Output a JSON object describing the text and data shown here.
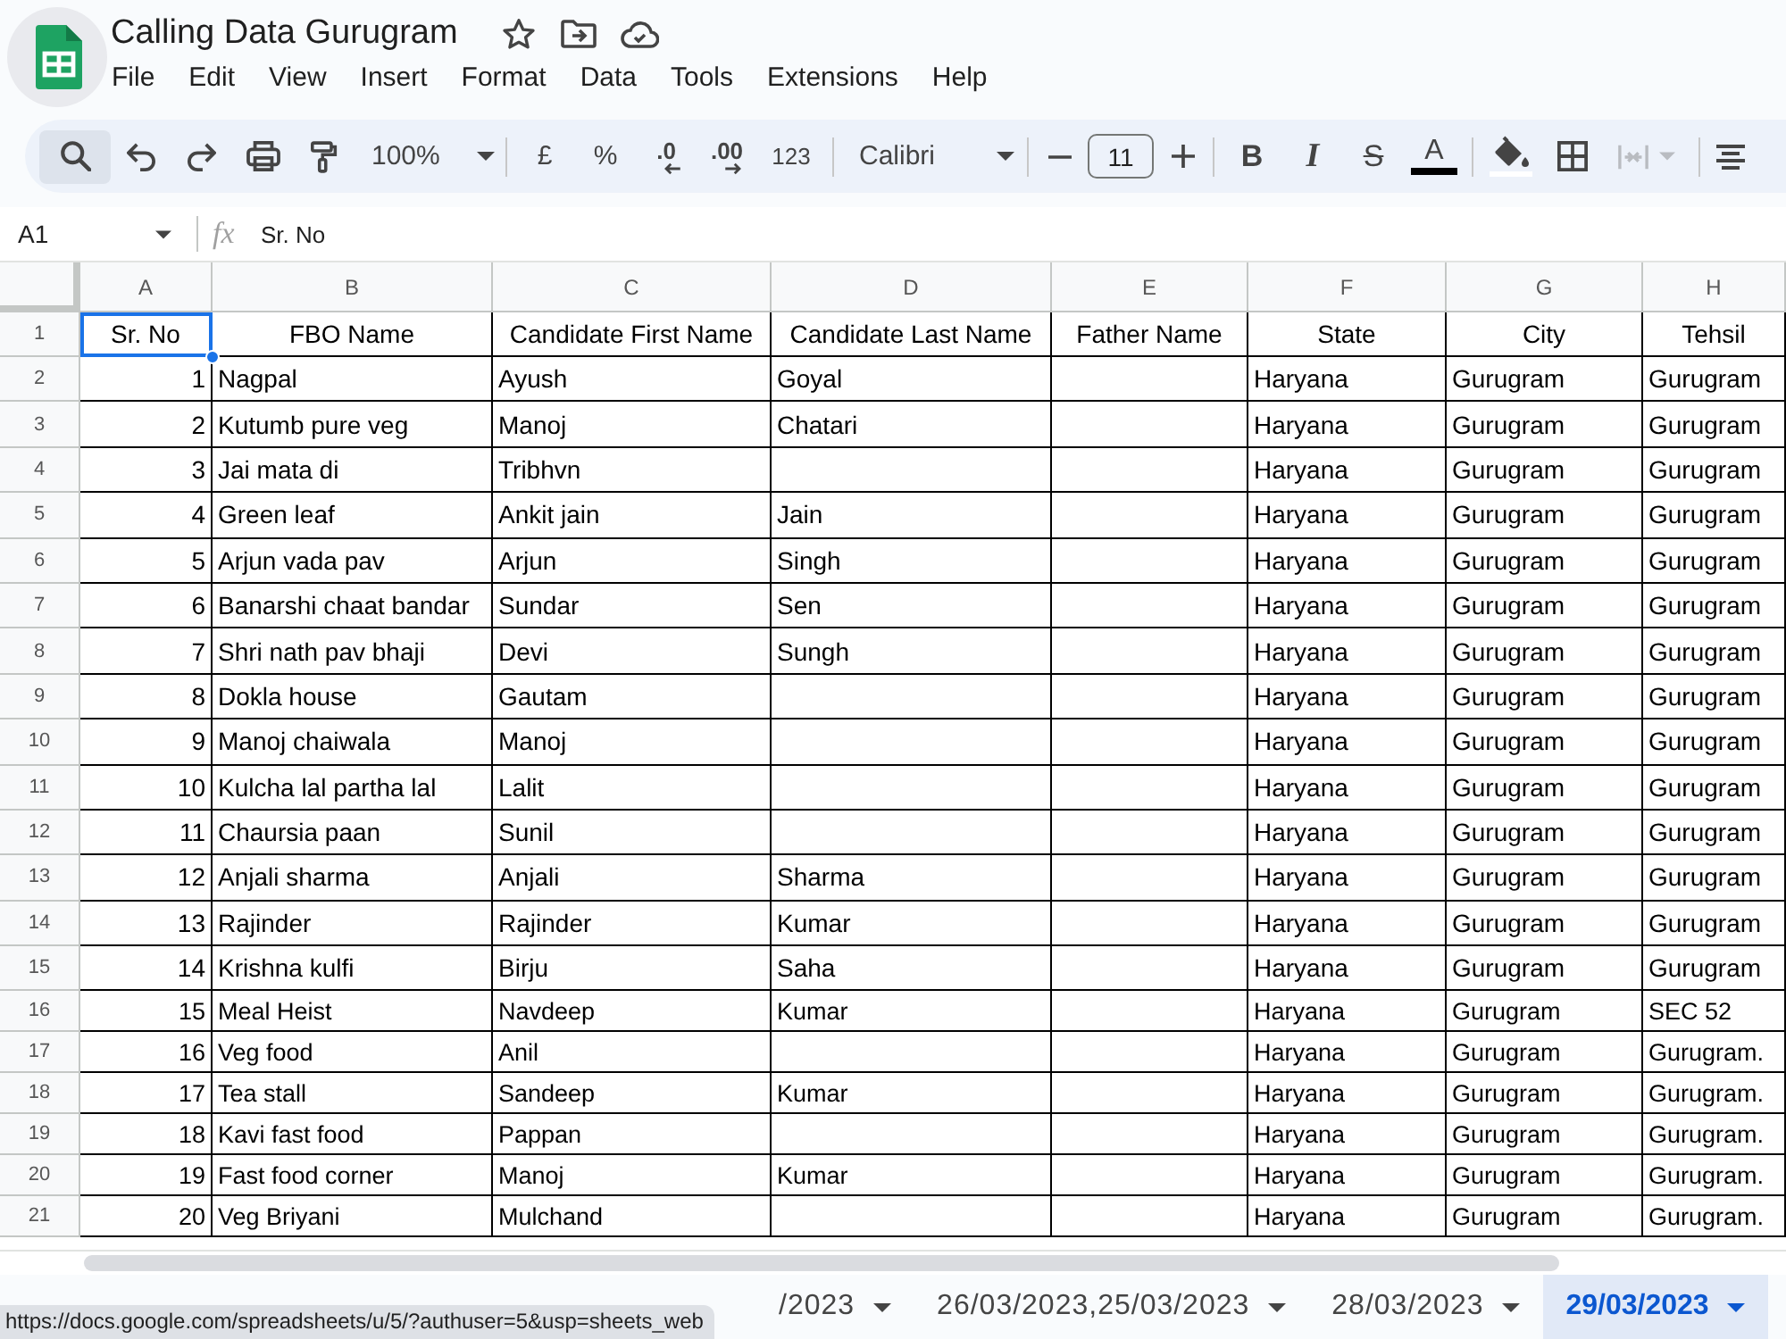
{
  "app": {
    "title": "Calling Data Gurugram",
    "menu": [
      "File",
      "Edit",
      "View",
      "Insert",
      "Format",
      "Data",
      "Tools",
      "Extensions",
      "Help"
    ]
  },
  "toolbar": {
    "search_selected": true,
    "zoom": "100%",
    "currency": "£",
    "percent": "%",
    "decrease_decimal": ".0",
    "increase_decimal": ".00",
    "number_format": "123",
    "font": "Calibri",
    "font_size": "11",
    "bold": "B",
    "italic": "I",
    "strikethrough": "S",
    "text_color": "A",
    "merge_disabled": true
  },
  "formula_bar": {
    "cell_ref": "A1",
    "fx": "fx",
    "content": "Sr. No"
  },
  "sheet": {
    "columns": [
      {
        "letter": "A",
        "selected": true
      },
      {
        "letter": "B",
        "selected": false
      },
      {
        "letter": "C",
        "selected": false
      },
      {
        "letter": "D",
        "selected": false
      },
      {
        "letter": "E",
        "selected": false
      },
      {
        "letter": "F",
        "selected": false
      },
      {
        "letter": "G",
        "selected": false
      },
      {
        "letter": "H",
        "selected": false
      }
    ],
    "rows": [
      {
        "row": "1",
        "kind": "header",
        "selected": true,
        "cells": [
          "Sr. No",
          "FBO Name",
          "Candidate First Name",
          "Candidate Last Name",
          "Father Name",
          "State",
          "City",
          "Tehsil"
        ]
      },
      {
        "row": "2",
        "kind": "entry",
        "selected": false,
        "cells": [
          "1",
          "Nagpal",
          "Ayush",
          "Goyal",
          null,
          "Haryana",
          "Gurugram",
          "Gurugram"
        ]
      },
      {
        "row": "3",
        "kind": "entry",
        "selected": false,
        "cells": [
          "2",
          "Kutumb pure veg",
          "Manoj",
          "Chatari",
          null,
          "Haryana",
          "Gurugram",
          "Gurugram"
        ]
      },
      {
        "row": "4",
        "kind": "entry",
        "selected": false,
        "cells": [
          "3",
          "Jai mata di",
          "Tribhvn",
          null,
          null,
          "Haryana",
          "Gurugram",
          "Gurugram"
        ]
      },
      {
        "row": "5",
        "kind": "entry",
        "selected": false,
        "cells": [
          "4",
          "Green leaf",
          "Ankit jain",
          "Jain",
          null,
          "Haryana",
          "Gurugram",
          "Gurugram"
        ]
      },
      {
        "row": "6",
        "kind": "entry",
        "selected": false,
        "cells": [
          "5",
          "Arjun vada pav",
          "Arjun",
          "Singh",
          null,
          "Haryana",
          "Gurugram",
          "Gurugram"
        ]
      },
      {
        "row": "7",
        "kind": "entry",
        "selected": false,
        "cells": [
          "6",
          "Banarshi chaat bandar",
          "Sundar",
          "Sen",
          null,
          "Haryana",
          "Gurugram",
          "Gurugram"
        ]
      },
      {
        "row": "8",
        "kind": "entry",
        "selected": false,
        "cells": [
          "7",
          "Shri nath pav bhaji",
          "Devi",
          "Sungh",
          null,
          "Haryana",
          "Gurugram",
          "Gurugram"
        ]
      },
      {
        "row": "9",
        "kind": "entry",
        "selected": false,
        "cells": [
          "8",
          "Dokla house",
          "Gautam",
          null,
          null,
          "Haryana",
          "Gurugram",
          "Gurugram"
        ]
      },
      {
        "row": "10",
        "kind": "entry",
        "selected": false,
        "cells": [
          "9",
          "Manoj chaiwala",
          "Manoj",
          null,
          null,
          "Haryana",
          "Gurugram",
          "Gurugram"
        ]
      },
      {
        "row": "11",
        "kind": "entry",
        "selected": false,
        "cells": [
          "10",
          "Kulcha lal partha lal",
          "Lalit",
          null,
          null,
          "Haryana",
          "Gurugram",
          "Gurugram"
        ]
      },
      {
        "row": "12",
        "kind": "entry",
        "selected": false,
        "cells": [
          "11",
          "Chaursia paan",
          "Sunil",
          null,
          null,
          "Haryana",
          "Gurugram",
          "Gurugram"
        ]
      },
      {
        "row": "13",
        "kind": "entry",
        "selected": false,
        "cells": [
          "12",
          "Anjali sharma",
          "Anjali",
          "Sharma",
          null,
          "Haryana",
          "Gurugram",
          "Gurugram"
        ]
      },
      {
        "row": "14",
        "kind": "entry",
        "selected": false,
        "cells": [
          "13",
          "Rajinder",
          "Rajinder",
          "Kumar",
          null,
          "Haryana",
          "Gurugram",
          "Gurugram"
        ]
      },
      {
        "row": "15",
        "kind": "entry",
        "selected": false,
        "cells": [
          "14",
          "Krishna kulfi",
          "Birju",
          "Saha",
          null,
          "Haryana",
          "Gurugram",
          "Gurugram"
        ]
      },
      {
        "row": "16",
        "kind": "plain",
        "selected": false,
        "cells": [
          "15",
          "Meal Heist",
          "Navdeep",
          "Kumar",
          null,
          "Haryana",
          "Gurugram",
          "SEC 52"
        ]
      },
      {
        "row": "17",
        "kind": "plain",
        "selected": false,
        "cells": [
          "16",
          "Veg food",
          "Anil",
          null,
          null,
          "Haryana",
          "Gurugram",
          "Gurugram."
        ]
      },
      {
        "row": "18",
        "kind": "plain",
        "selected": false,
        "cells": [
          "17",
          "Tea stall",
          "Sandeep",
          "Kumar",
          null,
          "Haryana",
          "Gurugram",
          "Gurugram."
        ]
      },
      {
        "row": "19",
        "kind": "plain",
        "selected": false,
        "cells": [
          "18",
          "Kavi fast food",
          "Pappan",
          null,
          null,
          "Haryana",
          "Gurugram",
          "Gurugram."
        ]
      },
      {
        "row": "20",
        "kind": "plain",
        "selected": false,
        "cells": [
          "19",
          "Fast food corner",
          "Manoj",
          "Kumar",
          null,
          "Haryana",
          "Gurugram",
          "Gurugram."
        ]
      },
      {
        "row": "21",
        "kind": "plain",
        "selected": false,
        "cells": [
          "20",
          "Veg Briyani",
          "Mulchand",
          null,
          null,
          "Haryana",
          "Gurugram",
          "Gurugram."
        ]
      }
    ]
  },
  "tabs": [
    {
      "label": "/2023",
      "selected": false
    },
    {
      "label": "26/03/2023,25/03/2023",
      "selected": false
    },
    {
      "label": "28/03/2023",
      "selected": false
    },
    {
      "label": "29/03/2023",
      "selected": true
    }
  ],
  "link_status": "https://docs.google.com/spreadsheets/u/5/?authuser=5&usp=sheets_web"
}
